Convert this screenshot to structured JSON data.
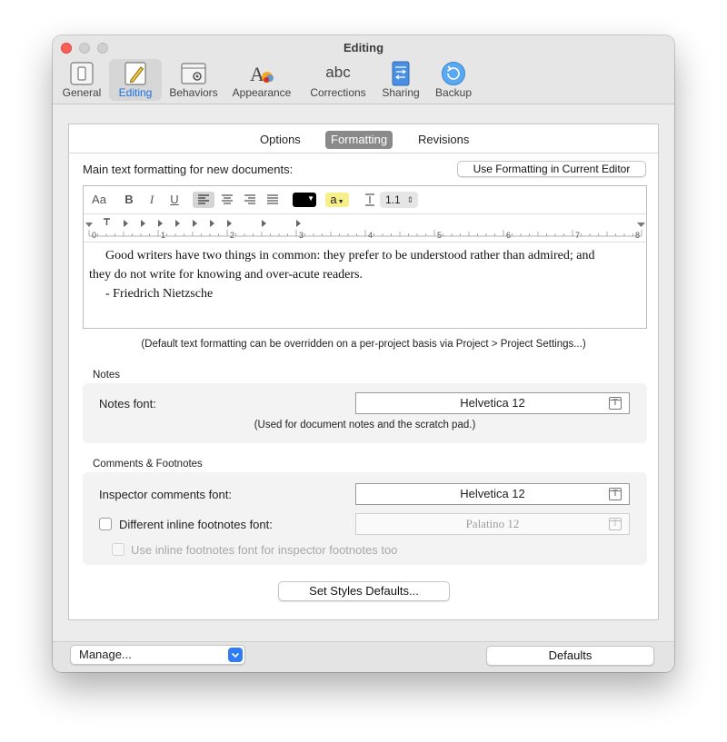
{
  "window": {
    "title": "Editing"
  },
  "toolbar": {
    "items": [
      {
        "label": "General"
      },
      {
        "label": "Editing"
      },
      {
        "label": "Behaviors"
      },
      {
        "label": "Appearance"
      },
      {
        "label": "Corrections"
      },
      {
        "label": "Sharing"
      },
      {
        "label": "Backup"
      }
    ],
    "corrections_icon_text": "abc"
  },
  "tabs": [
    {
      "label": "Options"
    },
    {
      "label": "Formatting",
      "selected": true
    },
    {
      "label": "Revisions"
    }
  ],
  "main_text": {
    "heading": "Main text formatting for new documents:",
    "use_current_button": "Use Formatting in Current Editor"
  },
  "format_bar": {
    "font_button": "Aa",
    "bold": "B",
    "italic": "I",
    "underline": "U",
    "text_color": "#000000",
    "highlight_color": "#f7f08a",
    "highlight_label": "a",
    "line_spacing": "1.1"
  },
  "ruler": {
    "numbers": [
      "0",
      "1",
      "2",
      "3",
      "4",
      "5",
      "6",
      "7",
      "8"
    ]
  },
  "sample_text": {
    "line1": "Good writers have two things in common: they prefer to be understood rather than admired; and",
    "line2": "they do not write for knowing and over-acute readers.",
    "line3": "- Friedrich Nietzsche"
  },
  "default_note": "(Default text formatting can be overridden on a per-project basis via Project > Project Settings...)",
  "notes": {
    "section": "Notes",
    "font_label": "Notes font:",
    "font_value": "Helvetica 12",
    "hint": "(Used for document notes and the scratch pad.)"
  },
  "comments": {
    "section": "Comments & Footnotes",
    "inspector_label": "Inspector comments font:",
    "inspector_value": "Helvetica 12",
    "inline_label": "Different inline footnotes font:",
    "inline_value": "Palatino 12",
    "inline_checked": false,
    "inspector_footnotes_label": "Use inline footnotes font for inspector footnotes too",
    "inspector_footnotes_checked": false
  },
  "set_styles_button": "Set Styles Defaults...",
  "bottom": {
    "manage": "Manage...",
    "defaults": "Defaults"
  }
}
